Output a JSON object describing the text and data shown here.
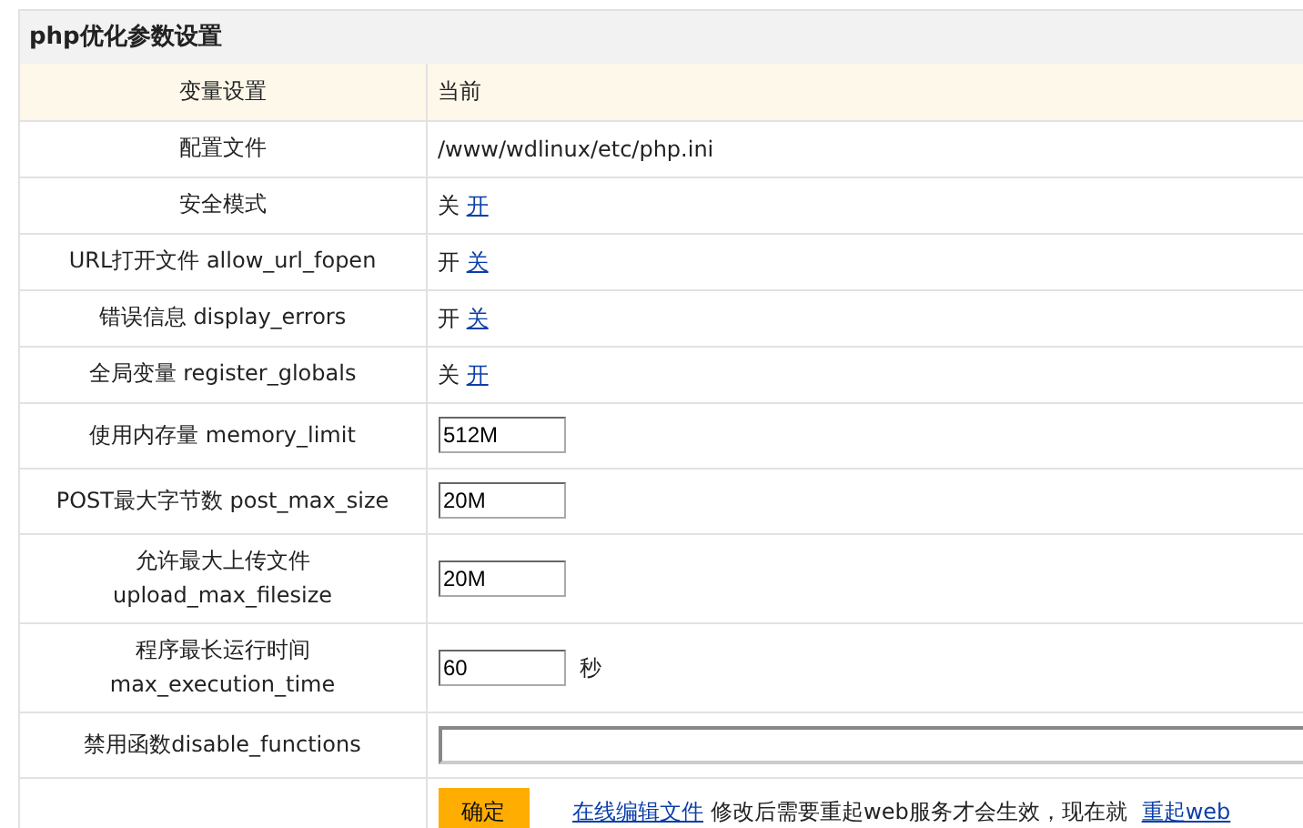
{
  "title": "php优化参数设置",
  "header": [
    "变量设置",
    "当前"
  ],
  "rows": [
    {
      "label": "配置文件",
      "kind": "text",
      "value": "/www/wdlinux/etc/php.ini"
    },
    {
      "label": "安全模式",
      "kind": "toggle",
      "value": "关",
      "link": "开"
    },
    {
      "label": "URL打开文件 allow_url_fopen",
      "kind": "toggle",
      "value": "开",
      "link": "关"
    },
    {
      "label": "错误信息 display_errors",
      "kind": "toggle",
      "value": "开",
      "link": "关"
    },
    {
      "label": "全局变量 register_globals",
      "kind": "toggle",
      "value": "关",
      "link": "开"
    },
    {
      "label": "使用内存量 memory_limit",
      "kind": "input",
      "value": "512M"
    },
    {
      "label": "POST最大字节数 post_max_size",
      "kind": "input",
      "value": "20M"
    },
    {
      "label": "允许最大上传文件 upload_max_filesize",
      "kind": "input",
      "value": "20M"
    },
    {
      "label": "程序最长运行时间 max_execution_time",
      "kind": "input",
      "value": "60",
      "unit": "秒"
    },
    {
      "label": "禁用函数disable_functions",
      "kind": "wide-input"
    }
  ],
  "footer": {
    "button": "确定",
    "edit_link": "在线编辑文件",
    "note": "修改后需要重起web服务才会生效，现在就",
    "restart_link": "重起web"
  }
}
